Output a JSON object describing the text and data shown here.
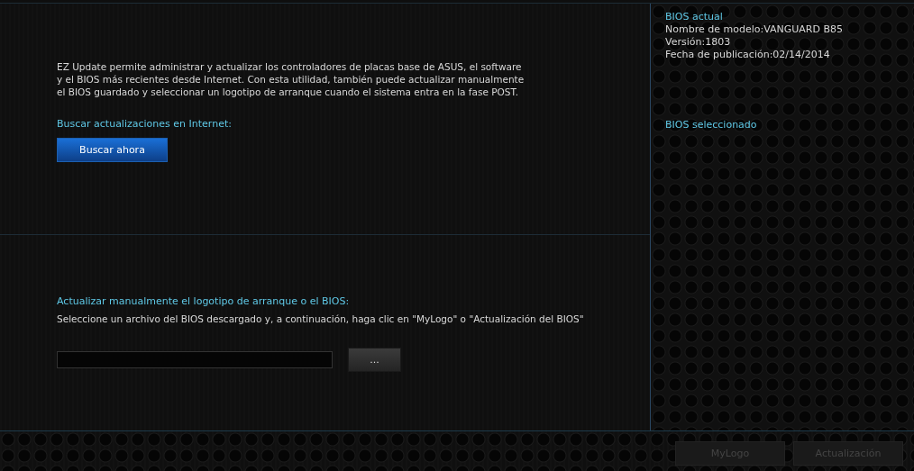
{
  "update": {
    "description": "EZ Update permite administrar y actualizar los controladores de placas base de ASUS, el software y el BIOS más recientes desde Internet. Con esta utilidad, también puede actualizar manualmente el BIOS guardado y seleccionar un logotipo de arranque cuando el sistema entra en la fase POST.",
    "search_label": "Buscar actualizaciones en Internet:",
    "search_button": "Buscar ahora"
  },
  "manual": {
    "title": "Actualizar manualmente el logotipo de arranque o el BIOS:",
    "instructions": "Seleccione un archivo del BIOS descargado y, a continuación, haga clic en \"MyLogo\" o \"Actualización del BIOS\"",
    "browse_button": "..."
  },
  "bios_info": {
    "current_title": "BIOS actual",
    "lines": [
      "Nombre de modelo:VANGUARD B85",
      "Versión:1803",
      "Fecha de publicación:02/14/2014"
    ],
    "selected_title": "BIOS seleccionado"
  },
  "actions": [
    {
      "label": "MyLogo",
      "disabled": true
    },
    {
      "label": "Actualización",
      "disabled": true
    }
  ]
}
